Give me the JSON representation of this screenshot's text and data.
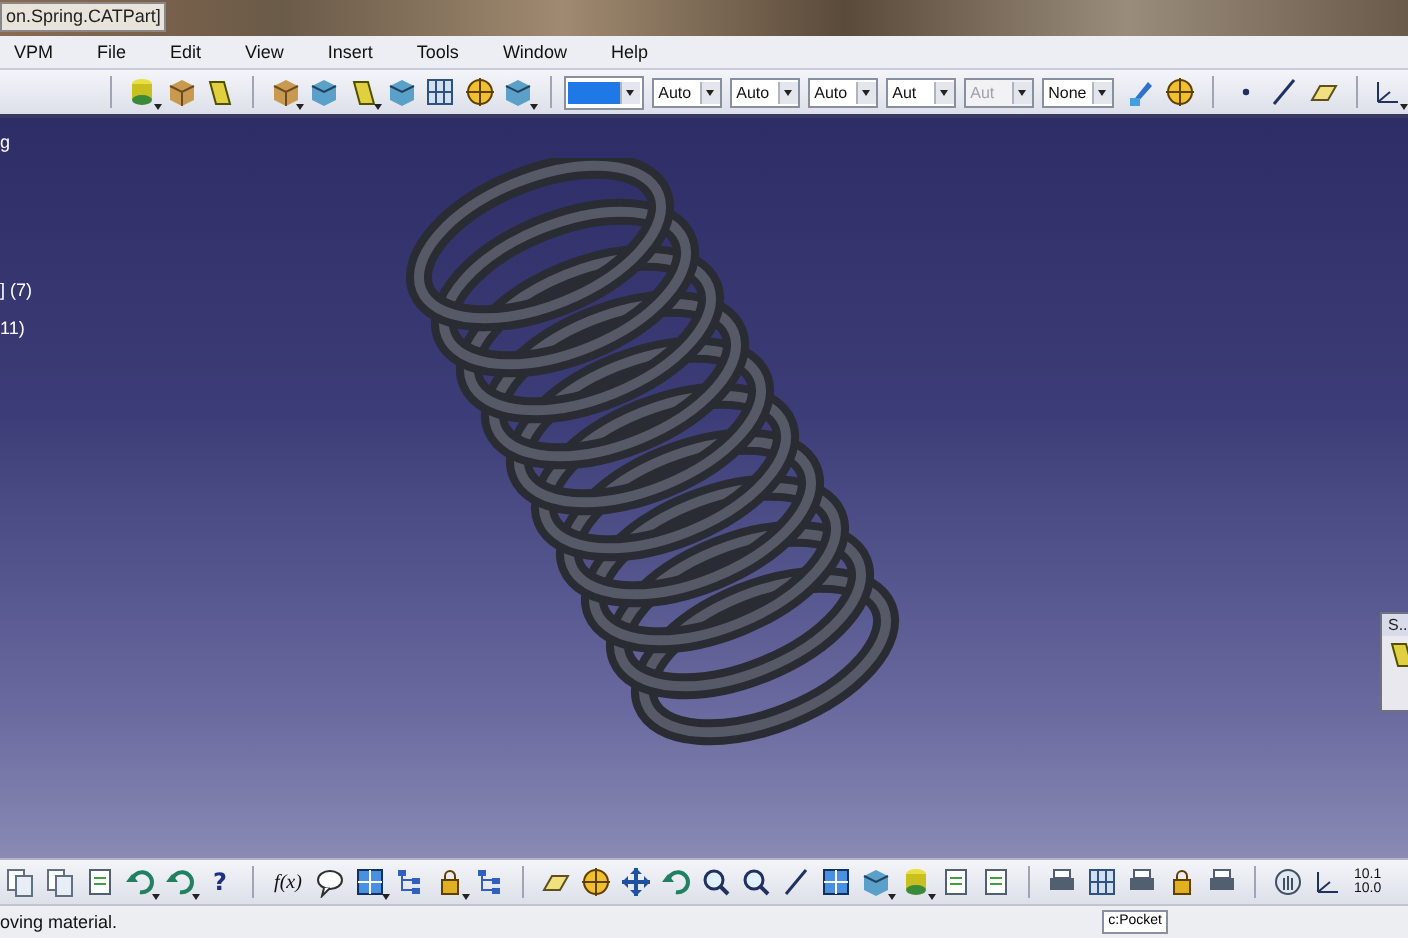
{
  "window": {
    "title": "on.Spring.CATPart]"
  },
  "menu_bar": {
    "items": [
      {
        "label": "VPM"
      },
      {
        "label": "File"
      },
      {
        "label": "Edit"
      },
      {
        "label": "View"
      },
      {
        "label": "Insert"
      },
      {
        "label": "Tools"
      },
      {
        "label": "Window"
      },
      {
        "label": "Help"
      }
    ]
  },
  "properties_toolbar": {
    "dropdowns": [
      {
        "kind": "color",
        "color": "#1e78e6",
        "disabled": false
      },
      {
        "kind": "text",
        "value": "Auto",
        "disabled": false
      },
      {
        "kind": "text",
        "value": "Auto",
        "disabled": false
      },
      {
        "kind": "text",
        "value": "Auto",
        "disabled": false
      },
      {
        "kind": "text",
        "value": "Aut",
        "disabled": false
      },
      {
        "kind": "text",
        "value": "Aut",
        "disabled": true
      },
      {
        "kind": "text",
        "value": "None",
        "disabled": false
      }
    ]
  },
  "specification_tree": {
    "items": [
      {
        "label": "g"
      },
      {
        "label": "] (7)"
      },
      {
        "label": "11)"
      }
    ]
  },
  "floating_panel": {
    "title": "S..."
  },
  "bottom_toolbar": {
    "formula_label": "f(x)",
    "help_label": "?"
  },
  "units_indicator": {
    "lines": [
      "10.1",
      "10.0"
    ]
  },
  "status_bar": {
    "message": "oving material.",
    "command_field": "c:Pocket"
  }
}
